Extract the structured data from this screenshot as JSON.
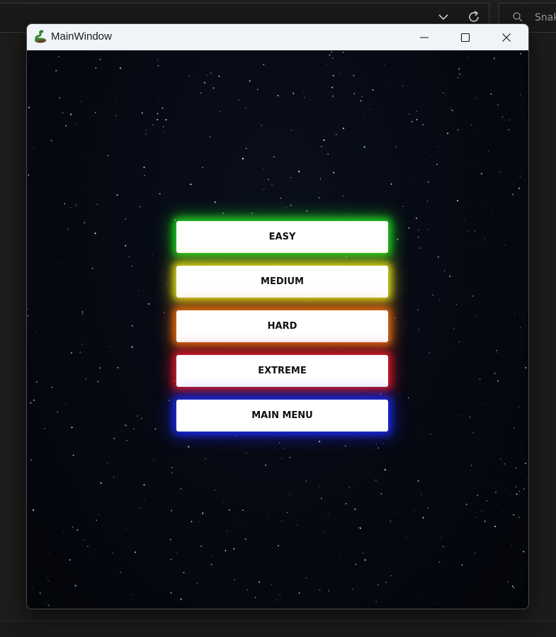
{
  "background": {
    "search_text": "Snak",
    "icons": [
      "chevron-down-icon",
      "refresh-icon",
      "search-icon"
    ]
  },
  "window": {
    "title": "MainWindow",
    "icons": [
      "snake-app-icon",
      "minimize-icon",
      "maximize-icon",
      "close-icon"
    ]
  },
  "menu": {
    "buttons": [
      {
        "label": "EASY",
        "glow": "#1ec81e"
      },
      {
        "label": "MEDIUM",
        "glow": "#d7d21a"
      },
      {
        "label": "HARD",
        "glow": "#e06a10"
      },
      {
        "label": "EXTREME",
        "glow": "#d01828"
      },
      {
        "label": "MAIN MENU",
        "glow": "#1a28e0"
      }
    ]
  }
}
